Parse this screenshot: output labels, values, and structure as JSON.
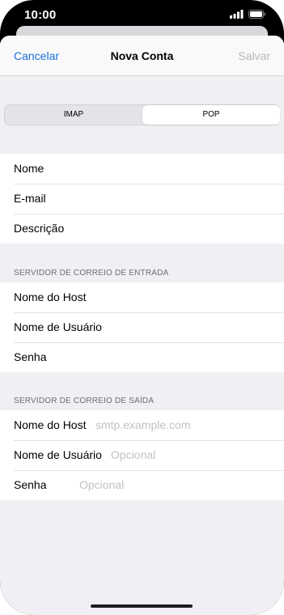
{
  "status": {
    "time": "10:00"
  },
  "nav": {
    "cancel": "Cancelar",
    "title": "Nova Conta",
    "save": "Salvar"
  },
  "segmented": {
    "imap": "IMAP",
    "pop": "POP",
    "selected": "POP"
  },
  "account": {
    "rows": [
      {
        "label": "Nome",
        "value": ""
      },
      {
        "label": "E-mail",
        "value": ""
      },
      {
        "label": "Descrição",
        "value": ""
      }
    ]
  },
  "incoming": {
    "header": "SERVIDOR DE CORREIO DE ENTRADA",
    "rows": [
      {
        "label": "Nome do Host",
        "value": ""
      },
      {
        "label": "Nome de Usuário",
        "value": ""
      },
      {
        "label": "Senha",
        "value": ""
      }
    ]
  },
  "outgoing": {
    "header": "SERVIDOR DE CORREIO DE SAÍDA",
    "rows": [
      {
        "label": "Nome do Host",
        "placeholder": "smtp.example.com"
      },
      {
        "label": "Nome de Usuário",
        "placeholder": "Opcional"
      },
      {
        "label": "Senha",
        "placeholder": "Opcional"
      }
    ]
  },
  "colors": {
    "accent": "#1a6fde",
    "background": "#efeff4",
    "separator": "#e3e3e6"
  }
}
